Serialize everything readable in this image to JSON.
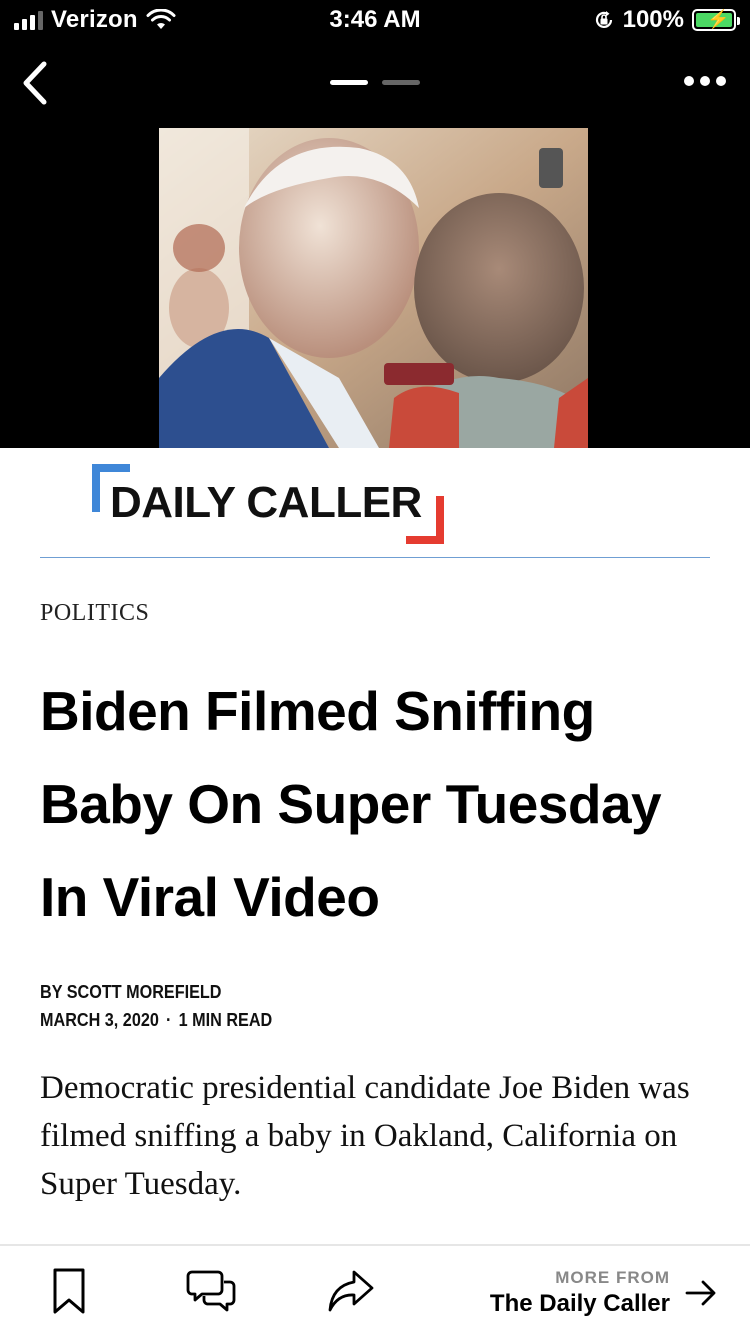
{
  "status_bar": {
    "carrier": "Verizon",
    "time": "3:46 AM",
    "battery": "100%"
  },
  "nav": {
    "back_icon": "chevron-left-icon",
    "more_icon": "ellipsis-icon",
    "pager_total": 2,
    "pager_active": 1
  },
  "article": {
    "publisher_logo": "DAILY CALLER",
    "category": "POLITICS",
    "headline": "Biden Filmed Sniffing Baby On Super Tuesday In Viral Video",
    "author": "BY SCOTT MOREFIELD",
    "date": "MARCH 3, 2020",
    "read_time": "1 MIN READ",
    "summary": "Democratic presidential candidate Joe Biden was filmed sniffing a baby in Oakland, California on Super Tuesday."
  },
  "toolbar": {
    "more_from_label": "MORE FROM",
    "source_name": "The Daily Caller"
  },
  "colors": {
    "logo_blue": "#3f87d8",
    "logo_red": "#e53b30",
    "divider": "#6f9ed3",
    "battery_green": "#4cd964"
  }
}
